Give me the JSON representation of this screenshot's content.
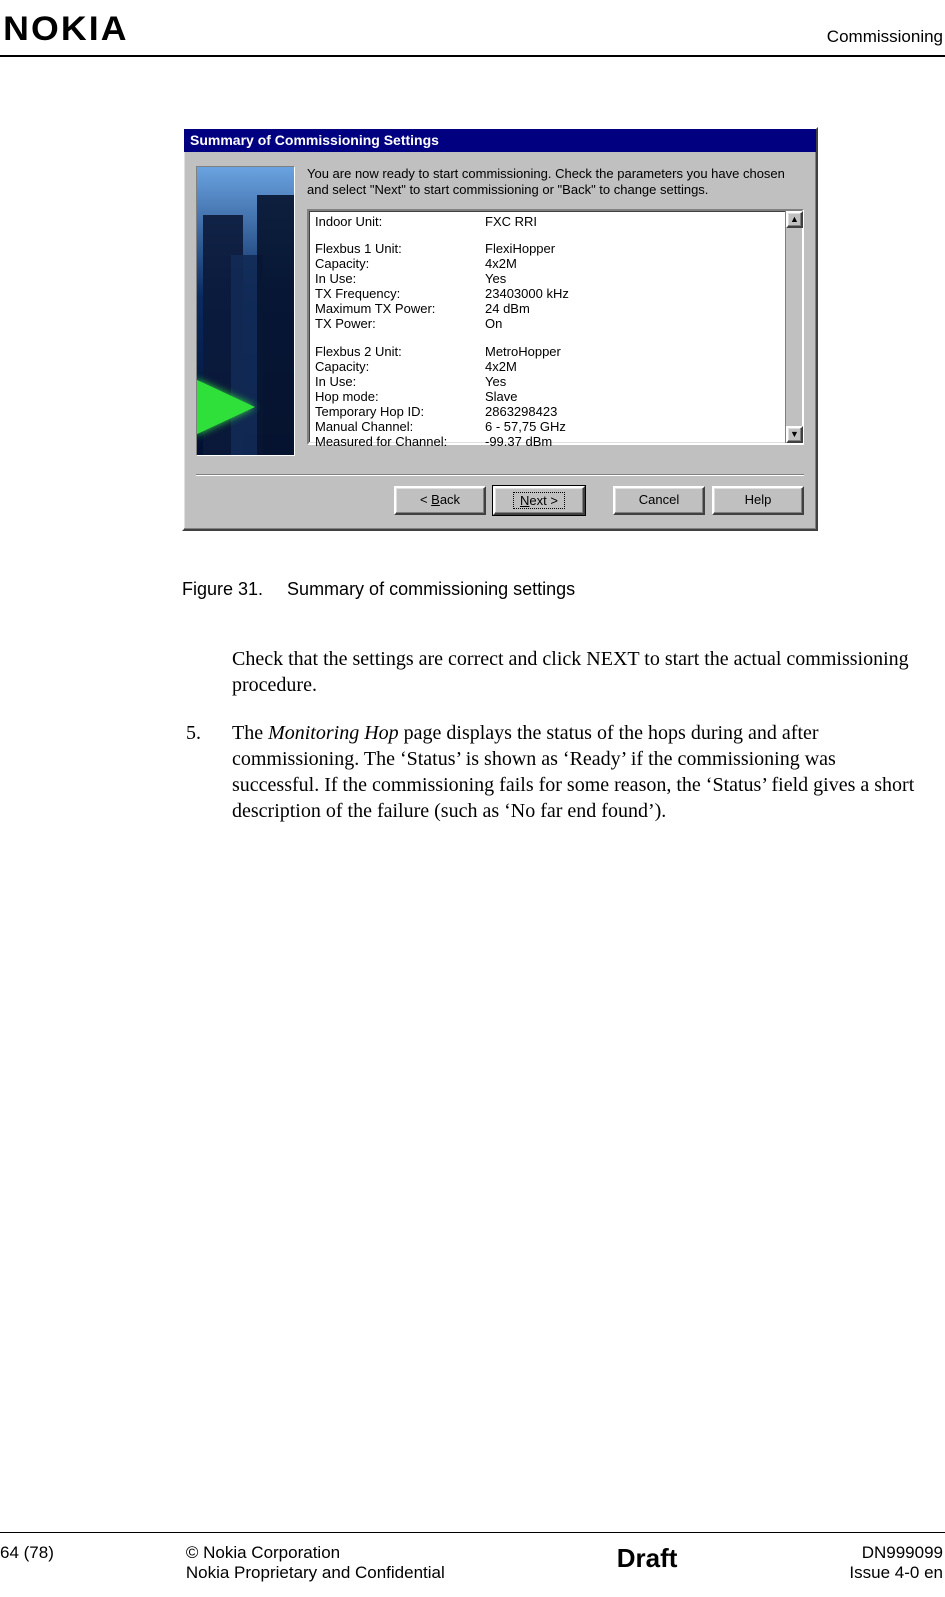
{
  "header": {
    "logo": "NOKIA",
    "section": "Commissioning"
  },
  "dialog": {
    "title": "Summary of Commissioning Settings",
    "instruction": "You are now ready to start commissioning. Check the parameters you have chosen and select \"Next\" to start commissioning or \"Back\" to change settings.",
    "rows": [
      {
        "k": "Indoor Unit:",
        "v": "FXC RRI"
      },
      {
        "blank": true
      },
      {
        "k": "Flexbus 1 Unit:",
        "v": "FlexiHopper"
      },
      {
        "k": "Capacity:",
        "v": "4x2M"
      },
      {
        "k": "In Use:",
        "v": "Yes"
      },
      {
        "k": "TX Frequency:",
        "v": "23403000 kHz"
      },
      {
        "k": "Maximum TX Power:",
        "v": "24 dBm"
      },
      {
        "k": "TX Power:",
        "v": "On"
      },
      {
        "blank": true
      },
      {
        "k": "Flexbus 2 Unit:",
        "v": "MetroHopper"
      },
      {
        "k": "Capacity:",
        "v": "4x2M"
      },
      {
        "k": "In Use:",
        "v": "Yes"
      },
      {
        "k": "Hop mode:",
        "v": "Slave"
      },
      {
        "k": "Temporary Hop ID:",
        "v": "2863298423"
      },
      {
        "k": "Manual Channel:",
        "v": "6  - 57,75 GHz"
      },
      {
        "k": "Measured for Channel:",
        "v": "-99.37 dBm"
      }
    ],
    "buttons": {
      "back_prefix": "< ",
      "back_u": "B",
      "back_suffix": "ack",
      "next_u": "N",
      "next_suffix": "ext >",
      "cancel": "Cancel",
      "help": "Help"
    }
  },
  "figure": {
    "num": "Figure 31.",
    "caption": "Summary of commissioning settings"
  },
  "para_check": "Check that the settings are correct and click NEXT to start the actual commissioning procedure.",
  "step5": {
    "num": "5.",
    "pre": "The ",
    "italic": "Monitoring Hop",
    "post": " page displays the status of the hops during and after commissioning. The ‘Status’ is shown as ‘Ready’ if the commissioning was successful. If the commissioning fails for some reason, the ‘Status’ field gives a short description of the failure (such as ‘No far end found’)."
  },
  "footer": {
    "page": "64 (78)",
    "copyright": "© Nokia Corporation",
    "confidential": "Nokia Proprietary and Confidential",
    "draft": "Draft",
    "doc": "DN999099",
    "issue": "Issue 4-0 en"
  }
}
